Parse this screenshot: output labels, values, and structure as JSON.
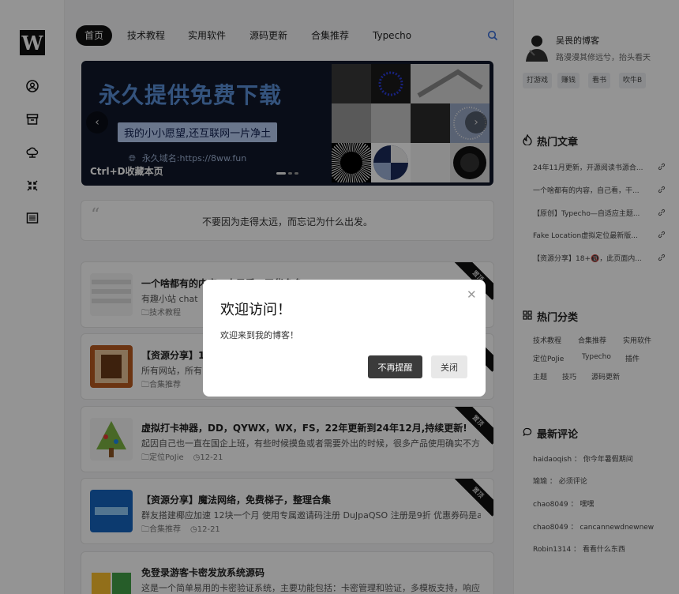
{
  "logo_text": "W",
  "nav": {
    "tabs": [
      {
        "label": "首页",
        "active": true
      },
      {
        "label": "技术教程"
      },
      {
        "label": "实用软件"
      },
      {
        "label": "源码更新"
      },
      {
        "label": "合集推荐"
      },
      {
        "label": "Typecho"
      }
    ]
  },
  "left_icons": [
    "user-circle-icon",
    "archive-icon",
    "cloud-icon",
    "shrink-icon",
    "list-icon"
  ],
  "banner": {
    "title": "永久提供免费下载",
    "subtitle": "我的小小愿望,还互联网一片净土",
    "domain": "永久域名:https://8ww.fun",
    "bookmark_hint": "Ctrl+D收藏本页"
  },
  "quote": {
    "text": "不要因为走得太远，而忘记为什么出发。"
  },
  "posts": [
    {
      "title": "一个啥都有的内容，自己看，干货多多",
      "excerpt": "有趣小站 chat",
      "category": "技术教程",
      "date": "",
      "ribbon": "置顶"
    },
    {
      "title": "【资源分享】18",
      "excerpt": "所有网站，所有",
      "category": "合集推荐",
      "date": "",
      "ribbon": "置顶"
    },
    {
      "title": "虚拟打卡神器，DD，QYWX，WX，FS，22年更新到24年12月,持续更新!",
      "excerpt": "起因自己也一直在国企上班，有些时候摸鱼或者需要外出的时候，很多产品使用确实不方...",
      "category": "定位PoJie",
      "date": "12-21",
      "ribbon": "置顶"
    },
    {
      "title": "【资源分享】魔法网络，免费梯子，整理合集",
      "excerpt": "群友搭建椰应加速 12块一个月 使用专属邀请码注册 DuJpaQSO 注册是9折 优惠券码是am...",
      "category": "合集推荐",
      "date": "12-21",
      "ribbon": "置顶"
    },
    {
      "title": "免登录游客卡密发放系统源码",
      "excerpt": "这是一个简单易用的卡密验证系统，主要功能包括：卡密管理和验证，多模板支持，响应...",
      "category": "",
      "date": "",
      "ribbon": ""
    }
  ],
  "sidebar": {
    "username": "吴畏的博客",
    "motto": "路漫漫其修远兮，抬头看天",
    "tags": [
      "打游戏",
      "赚钱",
      "看书",
      "吹牛B"
    ],
    "hot_articles_title": "热门文章",
    "hot_articles": [
      "24年11月更新，开源阅读书源合...",
      "一个啥都有的内容，自己看，干...",
      "【原创】Typecho—自适应主题...",
      "Fake Location虚拟定位最新版...",
      "【资源分享】18+🔞，此页面内..."
    ],
    "hot_categories_title": "热门分类",
    "categories": [
      "技术教程",
      "合集推荐",
      "实用软件",
      "定位PoJie",
      "Typecho",
      "插件",
      "主题",
      "技巧",
      "源码更新"
    ],
    "latest_comments_title": "最新评论",
    "comments": [
      {
        "user": "haidaoqish",
        "text": "你今年暑假期间"
      },
      {
        "user": "瑜瑜",
        "text": "必须评论"
      },
      {
        "user": "chao8049",
        "text": "嘿嘿"
      },
      {
        "user": "chao8049",
        "text": "cancannewdnewnew"
      },
      {
        "user": "Robin1314",
        "text": "看看什么东西"
      }
    ]
  },
  "dialog": {
    "title": "欢迎访问！",
    "message": "欢迎来到我的博客！",
    "dont_remind": "不再提醒",
    "close": "关闭"
  }
}
